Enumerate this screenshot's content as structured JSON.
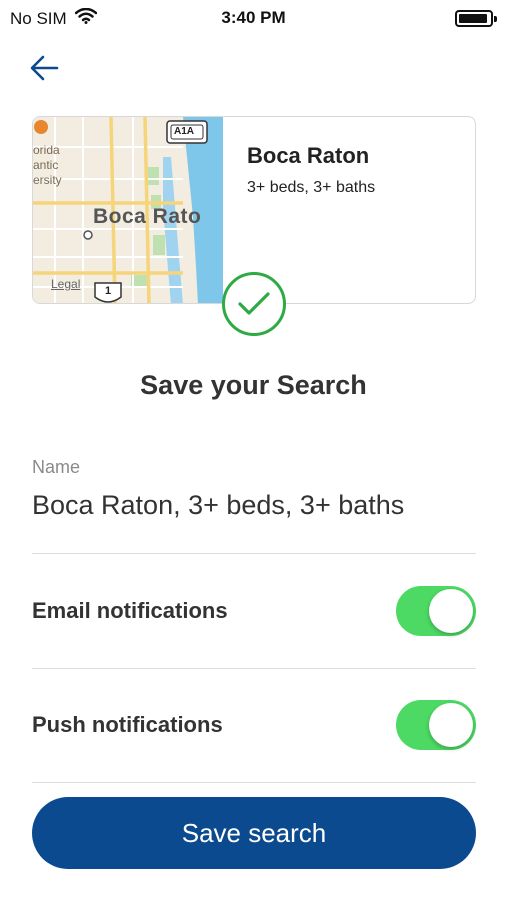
{
  "status_bar": {
    "carrier": "No SIM",
    "time": "3:40 PM"
  },
  "search": {
    "city": "Boca Raton",
    "criteria": "3+ beds, 3+ baths",
    "map": {
      "label_city": "Boca Rato",
      "label_university_lines": [
        "orida",
        "antic",
        "ersity"
      ],
      "road_shield_a1a": "A1A",
      "road_shield_us": "1",
      "legal": "Legal"
    }
  },
  "heading": "Save your Search",
  "name_field": {
    "label": "Name",
    "value": "Boca Raton, 3+ beds, 3+ baths"
  },
  "notifications": {
    "email": {
      "label": "Email notifications",
      "enabled": true
    },
    "push": {
      "label": "Push notifications",
      "enabled": true
    }
  },
  "save_button": "Save search",
  "colors": {
    "accent": "#0b4a8e",
    "toggle_on": "#4cd964",
    "success": "#2eaa44"
  }
}
